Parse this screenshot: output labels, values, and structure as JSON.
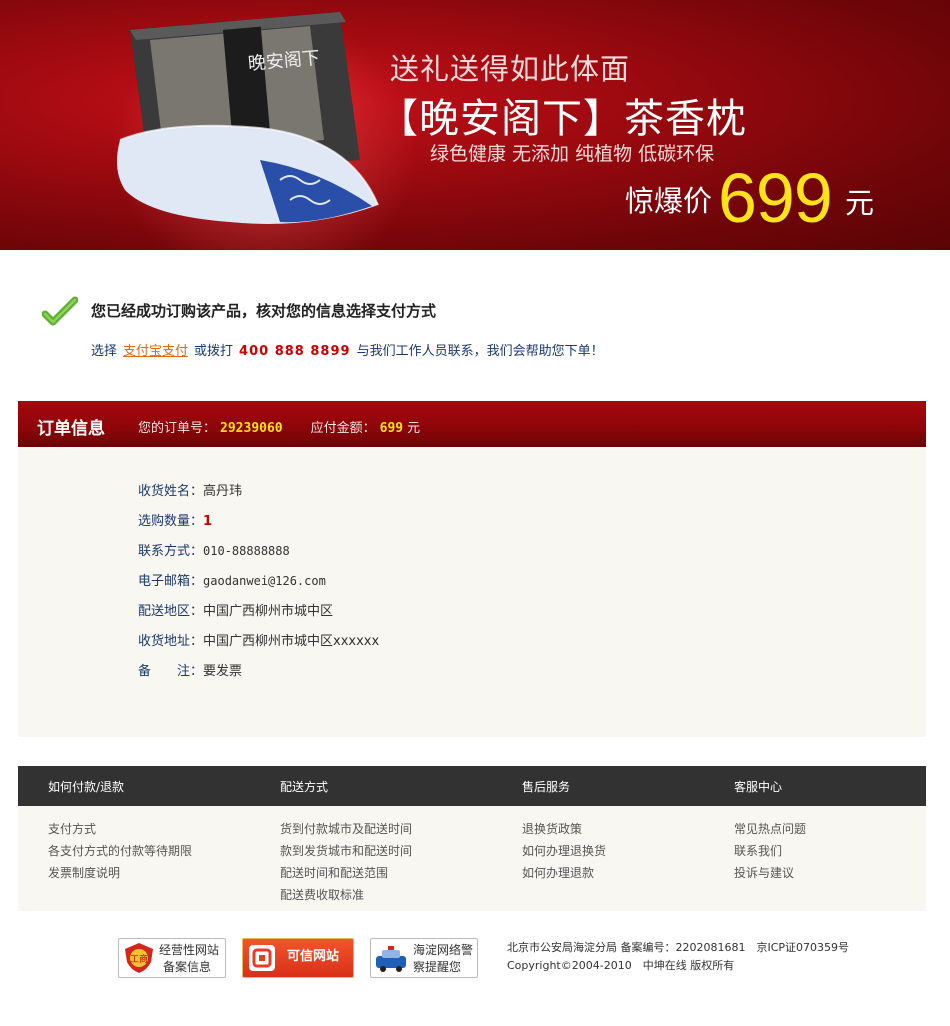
{
  "banner": {
    "box_lettering": "晚安阁下",
    "slogan_line1": "送礼送得如此体面",
    "slogan_line2": "【晚安阁下】茶香枕",
    "slogan_line3": "绿色健康 无添加 纯植物 低碳环保",
    "price_label": "惊爆价",
    "price_value": "699",
    "price_unit": "元"
  },
  "success": {
    "title": "您已经成功订购该产品，核对您的信息选择支付方式",
    "prefix": "选择",
    "pay_link": "支付宝支付",
    "middle": "或拨打",
    "phone": "400 888 8899",
    "suffix": "与我们工作人员联系，我们会帮助您下单！"
  },
  "order": {
    "title": "订单信息",
    "order_no_label": "您的订单号：",
    "order_no": "29239060",
    "amount_label": "应付金额：",
    "amount": "699",
    "amount_unit": "元",
    "fields": [
      {
        "label": "收货姓名：",
        "value": "高丹玮"
      },
      {
        "label": "选购数量：",
        "value": "1"
      },
      {
        "label": "联系方式：",
        "value": "010-88888888"
      },
      {
        "label": "电子邮箱：",
        "value": "gaodanwei@126.com"
      },
      {
        "label": "配送地区：",
        "value": "中国广西柳州市城中区"
      },
      {
        "label": "收货地址：",
        "value": "中国广西柳州市城中区xxxxxx"
      },
      {
        "label": "备　　注：",
        "value": "要发票"
      }
    ]
  },
  "footer": {
    "columns": [
      {
        "title": "如何付款/退款",
        "links": [
          "支付方式",
          "各支付方式的付款等待期限",
          "发票制度说明"
        ]
      },
      {
        "title": "配送方式",
        "links": [
          "货到付款城市及配送时间",
          "款到发货城市和配送时间",
          "配送时间和配送范围",
          "配送费收取标准"
        ]
      },
      {
        "title": "售后服务",
        "links": [
          "退换货政策",
          "如何办理退换货",
          "如何办理退款"
        ]
      },
      {
        "title": "客服中心",
        "links": [
          "常见热点问题",
          "联系我们",
          "投诉与建议"
        ]
      }
    ]
  },
  "badges": {
    "b1_line1": "经营性网站",
    "b1_line2": "备案信息",
    "b1_emblem": "工商",
    "b2_label": "可信网站",
    "b3_line1": "海淀网络警",
    "b3_line2": "察提醒您"
  },
  "copyright": {
    "line1": "北京市公安局海淀分局 备案编号：2202081681　京ICP证070359号",
    "line2": "Copyright©2004-2010　中坤在线 版权所有"
  },
  "colors": {
    "banner_red": "#9e0a10",
    "price_yellow": "#ffe21a",
    "link_orange": "#e06b0c",
    "label_blue": "#1b3a6b",
    "footer_dark": "#323232",
    "panel_bg": "#f9f7f1"
  }
}
